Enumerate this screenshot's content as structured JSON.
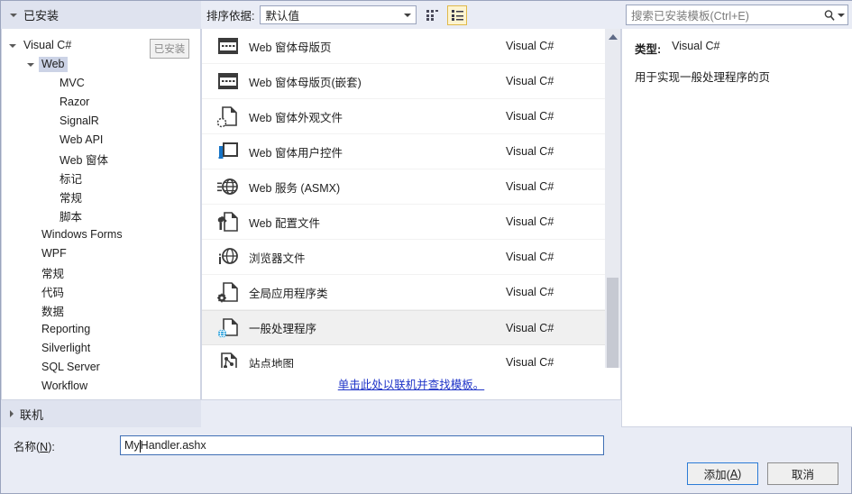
{
  "dialog": {
    "installed_header": "已安装",
    "installed_badge": "已安装",
    "online_node": "联机"
  },
  "toolbar": {
    "sort_label": "排序依据:",
    "sort_value": "默认值",
    "sort_options": [
      "默认值"
    ],
    "grid_view_name": "grid-view-icon",
    "list_view_name": "list-view-icon"
  },
  "search": {
    "placeholder": "搜索已安装模板(Ctrl+E)"
  },
  "tree": {
    "items": [
      {
        "label": "Visual C#",
        "indent": 0,
        "expander": "open",
        "selected": false
      },
      {
        "label": "Web",
        "indent": 1,
        "expander": "open",
        "selected": true
      },
      {
        "label": "MVC",
        "indent": 2,
        "expander": "none",
        "selected": false
      },
      {
        "label": "Razor",
        "indent": 2,
        "expander": "none",
        "selected": false
      },
      {
        "label": "SignalR",
        "indent": 2,
        "expander": "none",
        "selected": false
      },
      {
        "label": "Web API",
        "indent": 2,
        "expander": "none",
        "selected": false
      },
      {
        "label": "Web 窗体",
        "indent": 2,
        "expander": "none",
        "selected": false
      },
      {
        "label": "标记",
        "indent": 2,
        "expander": "none",
        "selected": false
      },
      {
        "label": "常规",
        "indent": 2,
        "expander": "none",
        "selected": false
      },
      {
        "label": "脚本",
        "indent": 2,
        "expander": "none",
        "selected": false
      },
      {
        "label": "Windows Forms",
        "indent": 1,
        "expander": "none",
        "selected": false
      },
      {
        "label": "WPF",
        "indent": 1,
        "expander": "none",
        "selected": false
      },
      {
        "label": "常规",
        "indent": 1,
        "expander": "none",
        "selected": false
      },
      {
        "label": "代码",
        "indent": 1,
        "expander": "none",
        "selected": false
      },
      {
        "label": "数据",
        "indent": 1,
        "expander": "none",
        "selected": false
      },
      {
        "label": "Reporting",
        "indent": 1,
        "expander": "none",
        "selected": false
      },
      {
        "label": "Silverlight",
        "indent": 1,
        "expander": "none",
        "selected": false
      },
      {
        "label": "SQL Server",
        "indent": 1,
        "expander": "none",
        "selected": false
      },
      {
        "label": "Workflow",
        "indent": 1,
        "expander": "none",
        "selected": false
      }
    ]
  },
  "templates": {
    "items": [
      {
        "name": "Web 窗体母版页",
        "lang": "Visual C#",
        "icon": "master-page-icon",
        "selected": false
      },
      {
        "name": "Web 窗体母版页(嵌套)",
        "lang": "Visual C#",
        "icon": "nested-master-page-icon",
        "selected": false
      },
      {
        "name": "Web 窗体外观文件",
        "lang": "Visual C#",
        "icon": "skin-file-icon",
        "selected": false
      },
      {
        "name": "Web 窗体用户控件",
        "lang": "Visual C#",
        "icon": "user-control-icon",
        "selected": false
      },
      {
        "name": "Web 服务 (ASMX)",
        "lang": "Visual C#",
        "icon": "web-service-icon",
        "selected": false
      },
      {
        "name": "Web 配置文件",
        "lang": "Visual C#",
        "icon": "web-config-icon",
        "selected": false
      },
      {
        "name": "浏览器文件",
        "lang": "Visual C#",
        "icon": "browser-file-icon",
        "selected": false
      },
      {
        "name": "全局应用程序类",
        "lang": "Visual C#",
        "icon": "global-asax-icon",
        "selected": false
      },
      {
        "name": "一般处理程序",
        "lang": "Visual C#",
        "icon": "generic-handler-icon",
        "selected": true
      },
      {
        "name": "站点地图",
        "lang": "Visual C#",
        "icon": "sitemap-icon",
        "selected": false
      }
    ],
    "online_link": "单击此处以联机并查找模板。"
  },
  "info": {
    "type_label": "类型:",
    "type_value": "Visual C#",
    "description": "用于实现一般处理程序的页"
  },
  "bottom": {
    "name_label_pre": "名称(",
    "name_label_key": "N",
    "name_label_post": "):",
    "name_value": "MyHandler.ashx",
    "name_value_before_caret": "My",
    "name_value_after_caret": "Handler.ashx",
    "add_pre": "添加(",
    "add_key": "A",
    "add_post": ")",
    "cancel_label": "取消"
  },
  "colors": {
    "dialog_bg": "#e9ecf5",
    "header_bg": "#dfe3ef",
    "selection_blue": "#ccd3e6",
    "link_blue": "#2035c8",
    "accent_yellow": "#e0b94a",
    "focus_blue": "#2b7bd6"
  }
}
